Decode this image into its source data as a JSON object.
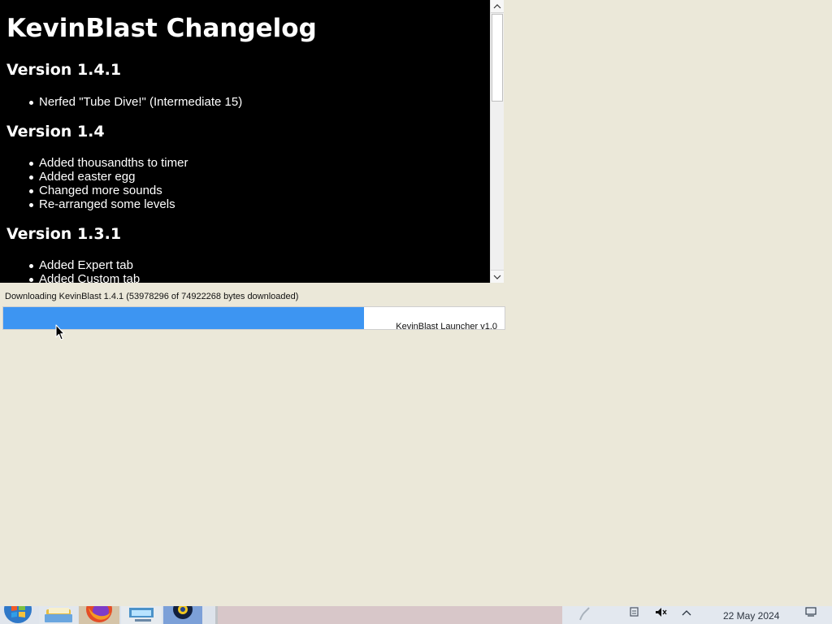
{
  "changelog": {
    "title": "KevinBlast Changelog",
    "versions": [
      {
        "heading": "Version 1.4.1",
        "items": [
          "Nerfed \"Tube Dive!\" (Intermediate 15)"
        ]
      },
      {
        "heading": "Version 1.4",
        "items": [
          "Added thousandths to timer",
          "Added easter egg",
          "Changed more sounds",
          "Re-arranged some levels"
        ]
      },
      {
        "heading": "Version 1.3.1",
        "items": [
          "Added Expert tab",
          "Added Custom tab"
        ]
      }
    ]
  },
  "download": {
    "status_text": "Downloading KevinBlast 1.4.1 (53978296 of 74922268 bytes downloaded)",
    "progress_fraction": 0.72,
    "launcher_version": "KevinBlast Launcher v1.0"
  },
  "taskbar": {
    "items": [
      "start-icon",
      "file-manager-icon",
      "firefox-icon",
      "remote-desktop-icon",
      "kevinblast-app-icon"
    ],
    "clock": "22 May 2024",
    "tray_icons": [
      "network-icon",
      "clipboard-icon",
      "volume-muted-icon",
      "expand-tray-icon",
      "desktop-icon"
    ]
  },
  "colors": {
    "desktop": "#ebe8d9",
    "changelog_background": "#000000",
    "changelog_text": "#ffffff",
    "progress": "#3d95f2"
  }
}
